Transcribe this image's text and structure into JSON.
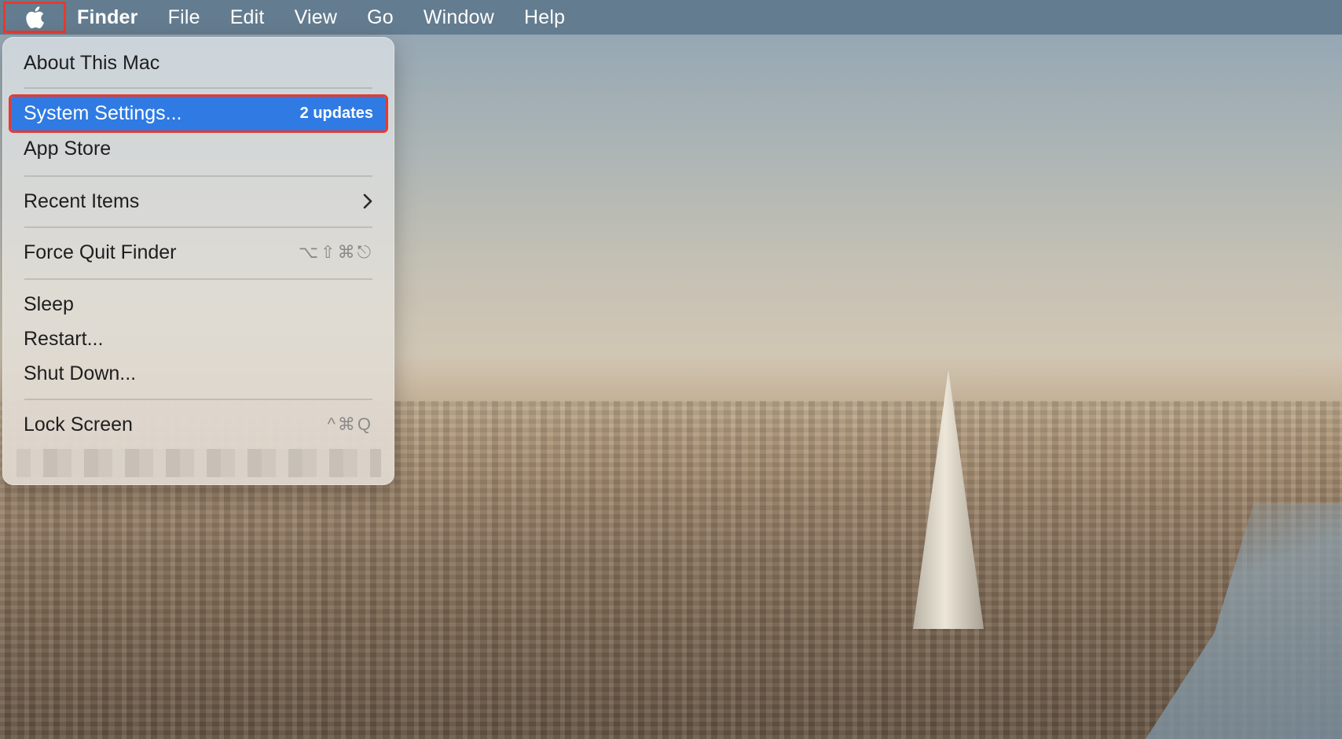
{
  "menubar": {
    "apple_icon": "apple-logo-icon",
    "app_name": "Finder",
    "items": [
      "File",
      "Edit",
      "View",
      "Go",
      "Window",
      "Help"
    ]
  },
  "apple_menu": {
    "about": "About This Mac",
    "system_settings": {
      "label": "System Settings...",
      "badge": "2 updates"
    },
    "app_store": "App Store",
    "recent_items": {
      "label": "Recent Items",
      "icon": "chevron-right-icon"
    },
    "force_quit": {
      "label": "Force Quit Finder",
      "shortcut": "⌥⇧⌘⎋"
    },
    "sleep": "Sleep",
    "restart": "Restart...",
    "shut_down": "Shut Down...",
    "lock_screen": {
      "label": "Lock Screen",
      "shortcut": "^⌘Q"
    }
  },
  "colors": {
    "highlight": "#2f7be3",
    "annotation_box": "#e8392f"
  }
}
